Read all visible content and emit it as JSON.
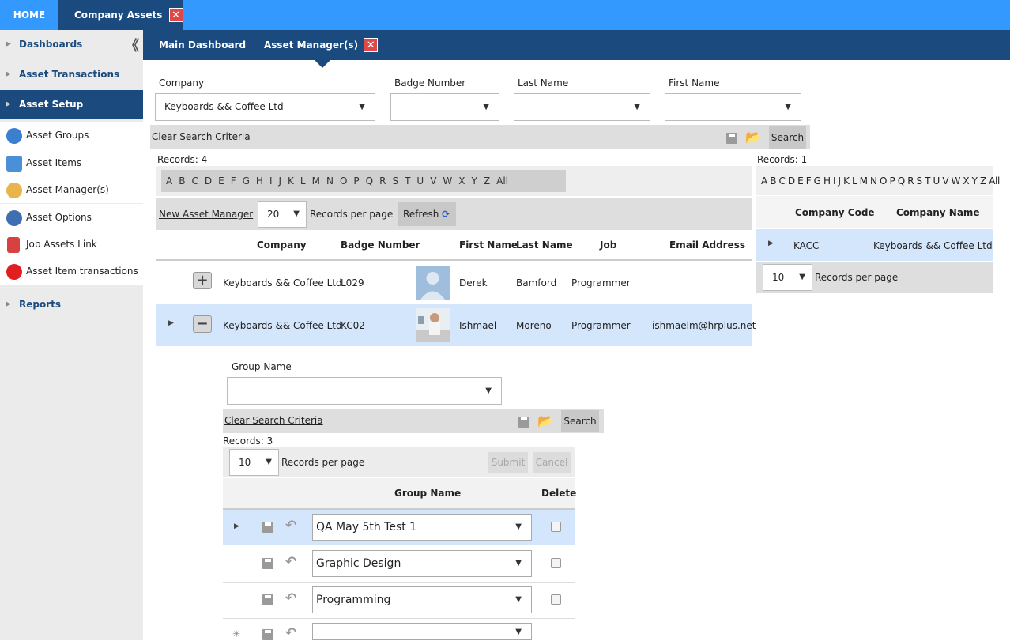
{
  "top_tabs": {
    "home": "HOME",
    "company_assets": "Company Assets",
    "close": "✕"
  },
  "sidebar": {
    "collapse": "《",
    "dashboards": "Dashboards",
    "asset_transactions": "Asset Transactions",
    "asset_setup": "Asset Setup",
    "items": [
      "Asset Groups",
      "Asset Items",
      "Asset Manager(s)",
      "Asset Options",
      "Job Assets Link",
      "Asset Item transactions"
    ],
    "reports": "Reports"
  },
  "sub_tabs": {
    "main_dashboard": "Main Dashboard",
    "asset_managers": "Asset Manager(s)",
    "close": "✕"
  },
  "filters": {
    "company_label": "Company",
    "company_value": "Keyboards && Coffee Ltd",
    "badge_label": "Badge Number",
    "badge_value": "",
    "last_name_label": "Last Name",
    "last_name_value": "",
    "first_name_label": "First Name",
    "first_name_value": ""
  },
  "search_bar": {
    "clear": "Clear Search Criteria",
    "search": "Search"
  },
  "managers": {
    "records_label": "Records:",
    "records_count": "4",
    "alphabet": [
      "A",
      "B",
      "C",
      "D",
      "E",
      "F",
      "G",
      "H",
      "I",
      "J",
      "K",
      "L",
      "M",
      "N",
      "O",
      "P",
      "Q",
      "R",
      "S",
      "T",
      "U",
      "V",
      "W",
      "X",
      "Y",
      "Z",
      "All"
    ],
    "new_link": "New Asset Manager",
    "page_size": "20",
    "rpp": "Records per page",
    "refresh": "Refresh",
    "columns": [
      "Company",
      "Badge Number",
      "First Name",
      "Last Name",
      "Job",
      "Email Address"
    ],
    "rows": [
      {
        "company": "Keyboards && Coffee Ltd",
        "badge": "L029",
        "first": "Derek",
        "last": "Bamford",
        "job": "Programmer",
        "email": ""
      },
      {
        "company": "Keyboards && Coffee Ltd",
        "badge": "KC02",
        "first": "Ishmael",
        "last": "Moreno",
        "job": "Programmer",
        "email": "ishmaelm@hrplus.net"
      }
    ]
  },
  "companies": {
    "records_label": "Records:",
    "records_count": "1",
    "alphabet": "A B C D E F G H I J K L M N O P Q R S T U V W X Y Z All",
    "columns": [
      "Company Code",
      "Company Name"
    ],
    "rows": [
      {
        "code": "KACC",
        "name": "Keyboards && Coffee Ltd"
      }
    ],
    "page_size": "10",
    "rpp": "Records per page"
  },
  "groups": {
    "group_name_label": "Group Name",
    "group_name_value": "",
    "clear": "Clear Search Criteria",
    "search": "Search",
    "records_label": "Records:",
    "records_count": "3",
    "page_size": "10",
    "rpp": "Records per page",
    "submit": "Submit",
    "cancel": "Cancel",
    "columns": [
      "Group Name",
      "Delete"
    ],
    "rows": [
      "QA May 5th Test 1",
      "Graphic Design",
      "Programming",
      ""
    ],
    "new_row_marker": "✳"
  }
}
